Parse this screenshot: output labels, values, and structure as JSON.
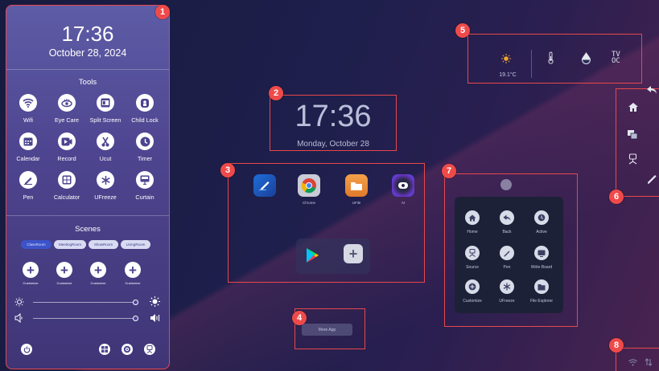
{
  "left_panel": {
    "time": "17:36",
    "date": "October 28, 2024",
    "tools_title": "Tools",
    "tools": [
      {
        "label": "Wifi",
        "icon": "wifi-icon"
      },
      {
        "label": "Eye Care",
        "icon": "eye-care-icon"
      },
      {
        "label": "Split Screen",
        "icon": "split-screen-icon"
      },
      {
        "label": "Child Lock",
        "icon": "child-lock-icon"
      },
      {
        "label": "Calendar",
        "icon": "calendar-icon"
      },
      {
        "label": "Record",
        "icon": "record-icon"
      },
      {
        "label": "Ucut",
        "icon": "scissors-icon"
      },
      {
        "label": "Timer",
        "icon": "timer-icon"
      },
      {
        "label": "Pen",
        "icon": "pen-icon"
      },
      {
        "label": "Calculator",
        "icon": "calculator-icon"
      },
      {
        "label": "UFreeze",
        "icon": "snowflake-icon"
      },
      {
        "label": "Curtain",
        "icon": "curtain-icon"
      }
    ],
    "scenes_title": "Scenes",
    "scenes": [
      {
        "label": "ClassRoom"
      },
      {
        "label": "MeetingRoom"
      },
      {
        "label": "ShowRoom"
      },
      {
        "label": "LivingRoom"
      }
    ],
    "customize": [
      "Customize",
      "Customize",
      "Customize",
      "Customize"
    ]
  },
  "clock": {
    "time": "17:36",
    "date": "Monday, October 28"
  },
  "apps": [
    {
      "label": "",
      "icon": "whiteboard-pen-app-icon"
    },
    {
      "label": "Chrome",
      "icon": "chrome-app-icon"
    },
    {
      "label": "UFile",
      "icon": "folder-app-icon"
    },
    {
      "label": "AI",
      "icon": "ai-app-icon"
    },
    {
      "label": "",
      "icon": "play-store-app-icon"
    },
    {
      "label": "",
      "icon": "add-app-icon"
    }
  ],
  "more_app": "More App",
  "status": {
    "temperature": "19.1°C",
    "tvoc_label": "TV\nOC"
  },
  "dock": {
    "buttons": [
      {
        "label": "Home",
        "icon": "home-icon"
      },
      {
        "label": "Back",
        "icon": "back-icon"
      },
      {
        "label": "Active",
        "icon": "active-icon"
      },
      {
        "label": "Source",
        "icon": "source-icon"
      },
      {
        "label": "Pen",
        "icon": "pen-icon"
      },
      {
        "label": "Write Board",
        "icon": "write-board-icon"
      },
      {
        "label": "Customize",
        "icon": "plus-icon"
      },
      {
        "label": "UFreeze",
        "icon": "snowflake-icon"
      },
      {
        "label": "File Explorer",
        "icon": "file-explorer-icon"
      }
    ]
  },
  "badges": [
    "1",
    "2",
    "3",
    "4",
    "5",
    "6",
    "7",
    "8"
  ],
  "colors": {
    "annotation": "#e8474b",
    "badge": "#ef4a4a",
    "panel": "#4e4590",
    "scene_selected": "#3c53c9"
  }
}
